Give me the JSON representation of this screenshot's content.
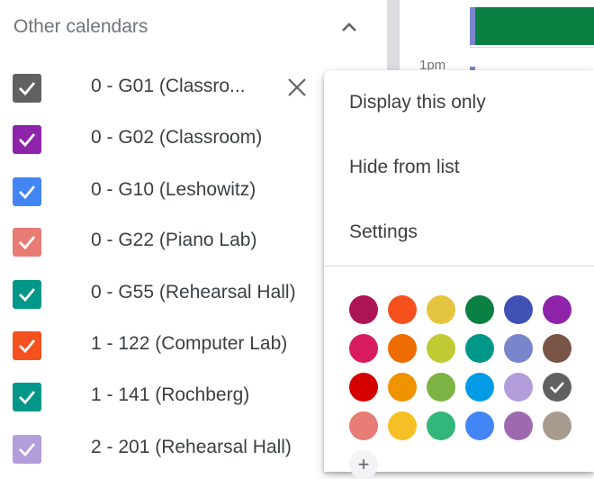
{
  "section": {
    "title": "Other calendars"
  },
  "calendars": [
    {
      "label": "0 - G01 (Classro...",
      "color": "#616161",
      "checked": true
    },
    {
      "label": "0 - G02 (Classroom)",
      "color": "#8e24aa",
      "checked": true
    },
    {
      "label": "0 - G10 (Leshowitz)",
      "color": "#4285f4",
      "checked": true
    },
    {
      "label": "0 - G22 (Piano Lab)",
      "color": "#e67c73",
      "checked": true
    },
    {
      "label": "0 - G55 (Rehearsal Hall)",
      "color": "#009688",
      "checked": true
    },
    {
      "label": "1 - 122 (Computer Lab)",
      "color": "#f4511e",
      "checked": true
    },
    {
      "label": "1 - 141 (Rochberg)",
      "color": "#009688",
      "checked": true
    },
    {
      "label": "2 - 201 (Rehearsal Hall)",
      "color": "#b39ddb",
      "checked": true
    }
  ],
  "grid": {
    "time_label": "1pm"
  },
  "menu": {
    "items": [
      {
        "label": "Display this only"
      },
      {
        "label": "Hide from list"
      },
      {
        "label": "Settings"
      }
    ],
    "add_color_label": "+",
    "palette": [
      [
        "#ad1457",
        "#f4511e",
        "#e4c441",
        "#0b8043",
        "#3f51b5",
        "#8e24aa"
      ],
      [
        "#d81b60",
        "#ef6c00",
        "#c0ca33",
        "#009688",
        "#7986cb",
        "#795548"
      ],
      [
        "#d50000",
        "#f09300",
        "#7cb342",
        "#039be5",
        "#b39ddb",
        "#616161"
      ],
      [
        "#e67c73",
        "#f6bf26",
        "#33b679",
        "#4285f4",
        "#9e69af",
        "#a79b8e"
      ]
    ],
    "selected_color": "#616161"
  }
}
